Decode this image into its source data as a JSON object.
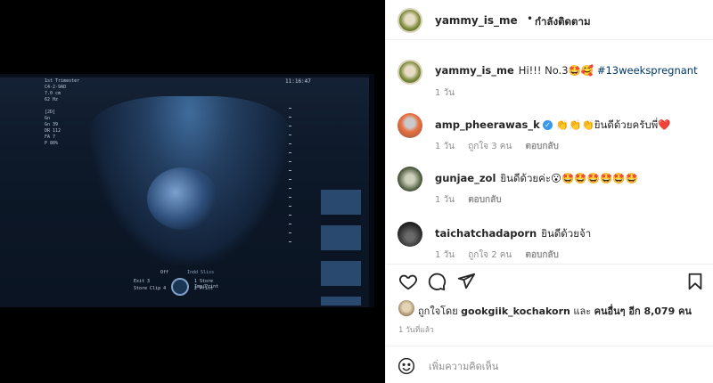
{
  "post": {
    "author": "yammy_is_me",
    "separator": "•",
    "follow_label": "กำลังติดตาม"
  },
  "media": {
    "us_info": "1st Trimester\nC4-2-9AD\n7.0 cm\n62 Hz\n\n[2D]\nGn\nGn 39\nDR 112\nFA 7\nP 80%",
    "us_time": "11:16:47",
    "us_off": "Off",
    "us_slot": "Indd Sliss",
    "us_exit": "Exit 3",
    "us_store": "Store Clip 4",
    "us_print": "1 Store Img/Print",
    "us_print2": "2 Print"
  },
  "comments": [
    {
      "user": "yammy_is_me",
      "text": "Hi!!! No.3🤩🥰",
      "tag": "#13weekspregnant",
      "time": "1 วัน",
      "likes": "",
      "reply": "",
      "verified": false,
      "avatar_icon": "profile-yammy"
    },
    {
      "user": "amp_pheerawas_k",
      "text": "👏👏👏ยินดีด้วยครับพี่❤️",
      "tag": "",
      "time": "1 วัน",
      "likes": "ถูกใจ 3 คน",
      "reply": "ตอบกลับ",
      "verified": true,
      "avatar_icon": "profile-amp"
    },
    {
      "user": "gunjae_zol",
      "text": "ยินดีด้วยค่ะ😮🤩🤩🤩🤩🤩🤩",
      "tag": "",
      "time": "1 วัน",
      "likes": "",
      "reply": "ตอบกลับ",
      "verified": false,
      "avatar_icon": "profile-gunjae"
    },
    {
      "user": "taichatchadaporn",
      "text": "ยินดีด้วยจ้า",
      "tag": "",
      "time": "1 วัน",
      "likes": "ถูกใจ 2 คน",
      "reply": "ตอบกลับ",
      "verified": false,
      "avatar_icon": "profile-taich"
    }
  ],
  "actions": {
    "like_icon": "heart-icon",
    "comment_icon": "comment-icon",
    "share_icon": "share-icon",
    "save_icon": "bookmark-icon"
  },
  "likes": {
    "prefix": "ถูกใจโดย",
    "user": "gookgiik_kochakorn",
    "and": "และ",
    "others": "คนอื่นๆ อีก 8,079 คน"
  },
  "time_ago": "1 วันที่แล้ว",
  "add_comment": {
    "placeholder": "เพิ่มความคิดเห็น"
  },
  "colors": {
    "link": "#00376b",
    "verified": "#3897f0",
    "muted": "#8e8e8e"
  }
}
